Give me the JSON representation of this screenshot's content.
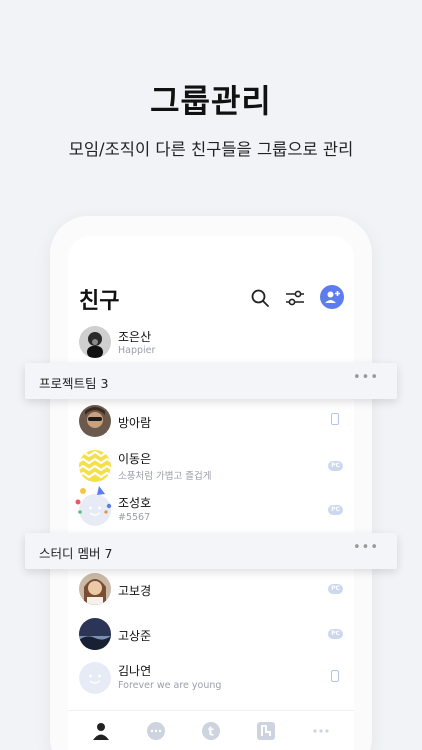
{
  "hero": {
    "title": "그룹관리",
    "subtitle": "모임/조직이 다른 친구들을 그룹으로 관리"
  },
  "app": {
    "title": "친구",
    "icons": [
      "search-icon",
      "filter-icon",
      "add-friend-icon"
    ]
  },
  "friends": {
    "top": {
      "name": "조은산",
      "status": "Happier"
    },
    "group1": [
      {
        "name": "방아람",
        "status": "",
        "device": "mobile"
      },
      {
        "name": "이동은",
        "status": "소풍처럼 가볍고 즐겁게",
        "device": "PC"
      },
      {
        "name": "조성호",
        "status": "#5567",
        "device": "PC"
      }
    ],
    "group2": [
      {
        "name": "고보경",
        "status": "",
        "device": "PC"
      },
      {
        "name": "고상준",
        "status": "",
        "device": "PC"
      },
      {
        "name": "김나연",
        "status": "Forever we are young",
        "device": "mobile"
      }
    ]
  },
  "groups": [
    {
      "label": "프로젝트팀 3",
      "more": "•••"
    },
    {
      "label": "스터디 멤버 7",
      "more": "•••"
    }
  ],
  "tabbar": {
    "tabs": [
      "person-icon",
      "chat-icon",
      "t-icon",
      "n-icon",
      "more-icon"
    ],
    "active": "person-icon"
  },
  "colors": {
    "accent": "#5d7cf0",
    "badge": "#ccd8ee"
  }
}
